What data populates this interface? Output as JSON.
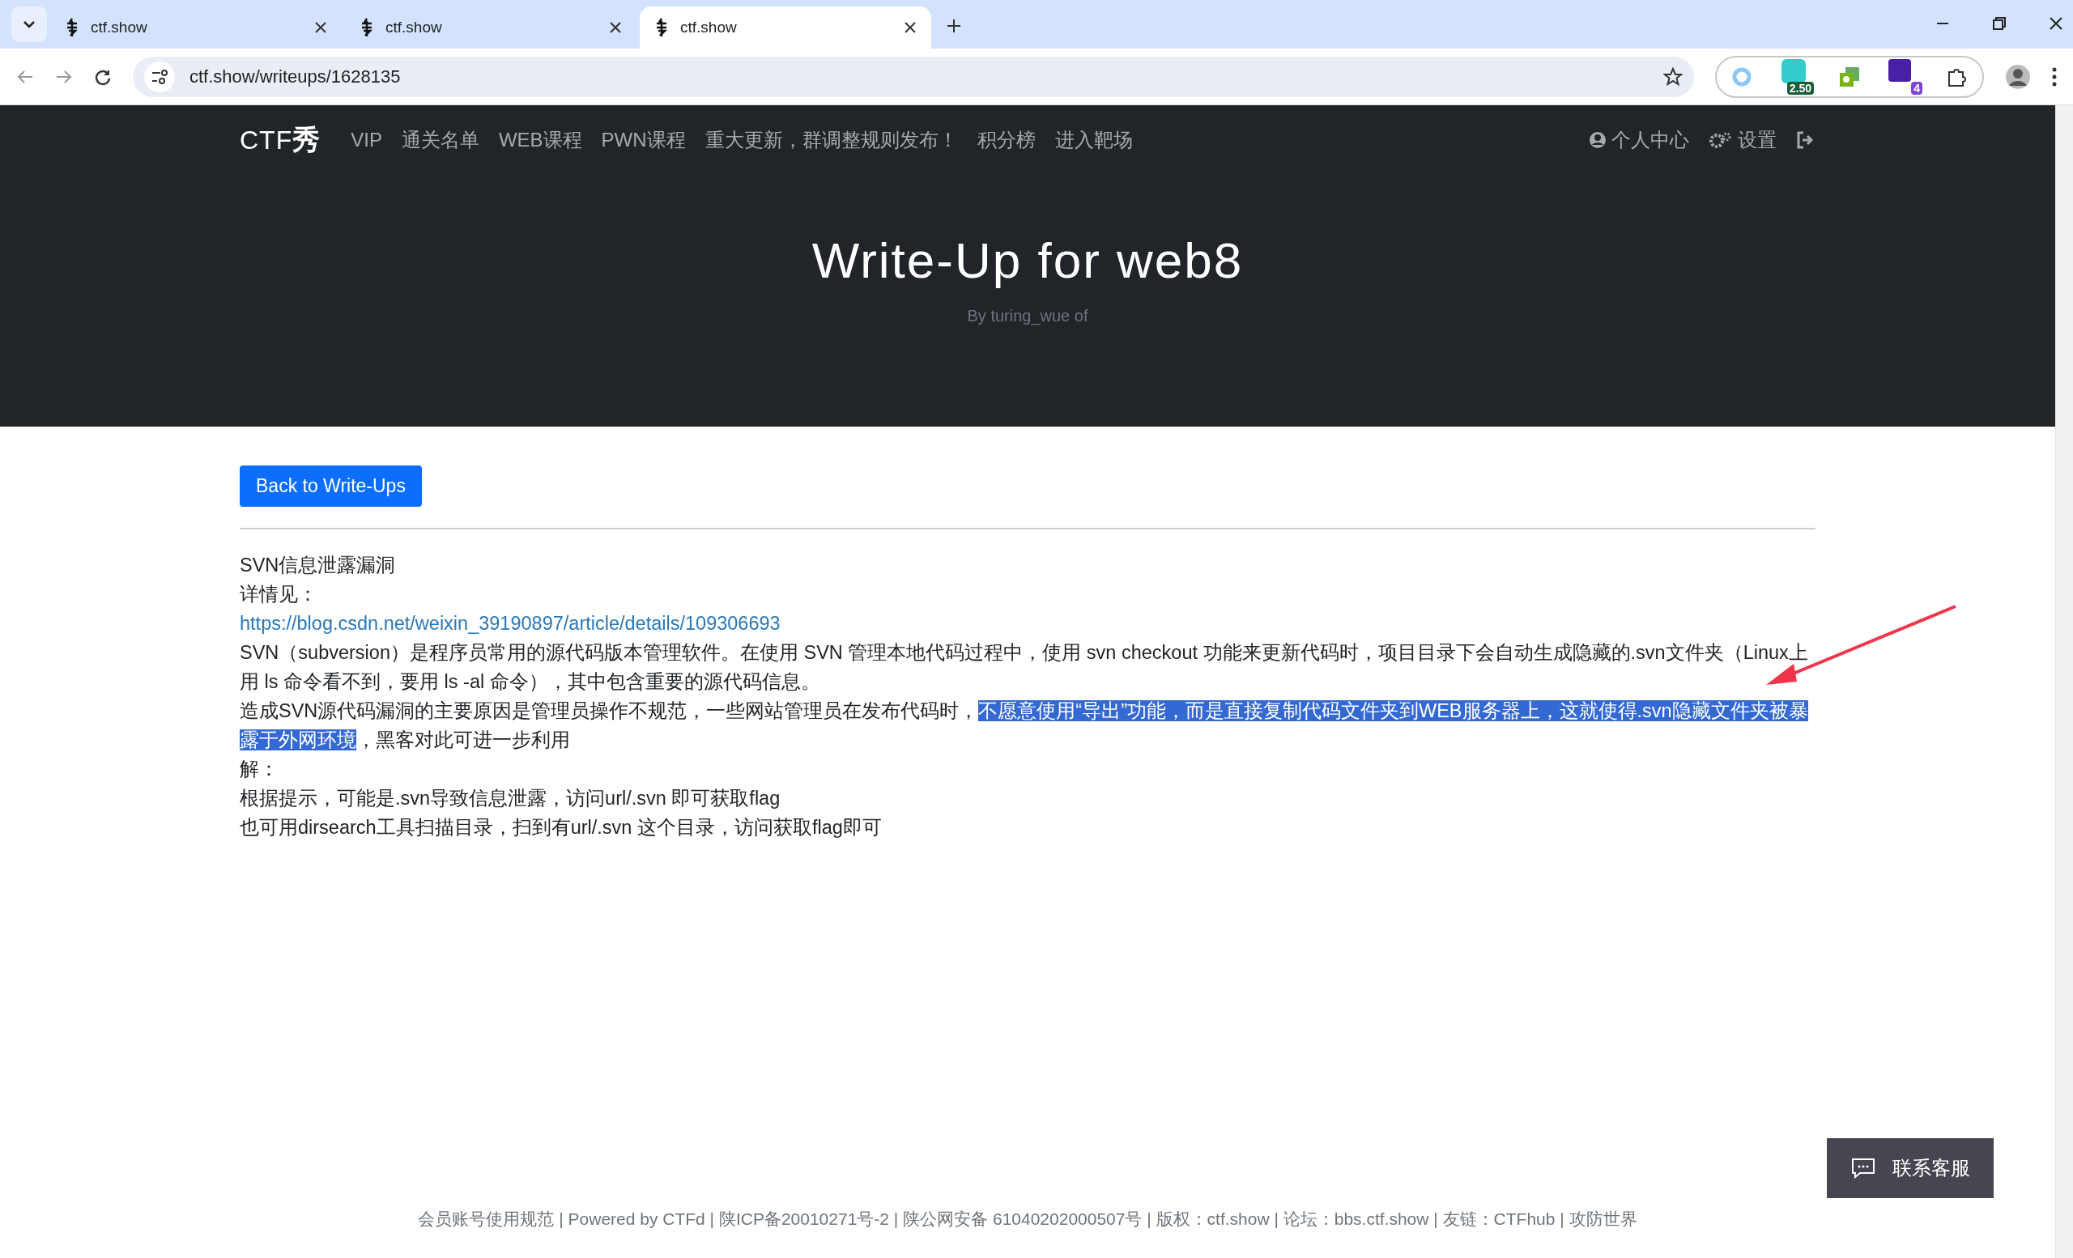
{
  "browser": {
    "tabs": [
      {
        "title": "ctf.show",
        "selected": false
      },
      {
        "title": "ctf.show",
        "selected": false
      },
      {
        "title": "ctf.show",
        "selected": true
      }
    ],
    "address": "ctf.show/writeups/1628135",
    "extension_badges": [
      "2.50",
      "4"
    ]
  },
  "nav": {
    "logo": "CTF",
    "logo_mark": "秀",
    "items": [
      "VIP",
      "通关名单",
      "WEB课程",
      "PWN课程",
      "重大更新，群调整规则发布！",
      "积分榜",
      "进入靶场"
    ],
    "right_items": [
      {
        "kind": "user",
        "label": "个人中心"
      },
      {
        "kind": "settings",
        "label": "设置"
      },
      {
        "kind": "logout"
      }
    ]
  },
  "hero": {
    "title": "Write-Up for web8",
    "byline": "By turing_wue of"
  },
  "back_button": "Back to Write-Ups",
  "content": [
    {
      "kind": "text",
      "text": "SVN信息泄露漏洞"
    },
    {
      "kind": "text",
      "text": "详情见："
    },
    {
      "kind": "link",
      "text": "https://blog.csdn.net/weixin_39190897/article/details/109306693"
    },
    {
      "kind": "text",
      "text": "SVN（subversion）是程序员常用的源代码版本管理软件。在使用 SVN 管理本地代码过程中，使用 svn checkout 功能来更新代码时，项目目录下会自动生成隐藏的.svn文件夹（Linux上用 ls 命令看不到，要用 ls -al 命令），其中包含重要的源代码信息。"
    },
    {
      "kind": "selection",
      "before": "造成SVN源代码漏洞的主要原因是管理员操作不规范，一些网站管理员在发布代码时，",
      "selected": "不愿意使用“导出”功能，而是直接复制代码文件夹到WEB服务器上，这就使得.svn隐藏文件夹被暴露于外网环境",
      "after": "，黑客对此可进一步利用"
    },
    {
      "kind": "text",
      "text": "解："
    },
    {
      "kind": "text",
      "text": "根据提示，可能是.svn导致信息泄露，访问url/.svn 即可获取flag"
    },
    {
      "kind": "text",
      "text": "也可用dirsearch工具扫描目录，扫到有url/.svn 这个目录，访问获取flag即可"
    }
  ],
  "chat_button": "联系客服",
  "footer": "会员账号使用规范 | Powered by CTFd | 陕ICP备20010271号-2 | 陕公网安备 61040202000507号 | 版权：ctf.show | 论坛：bbs.ctf.show | 友链：CTFhub | 攻防世界"
}
